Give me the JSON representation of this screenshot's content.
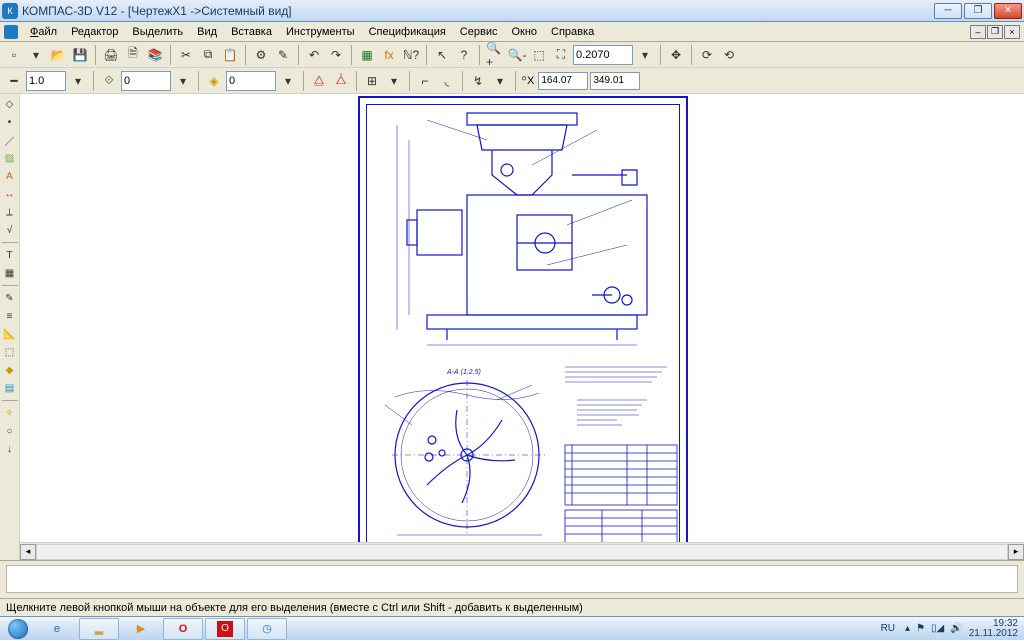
{
  "title": "КОМПАС-3D V12 - [ЧертежX1 ->Системный вид]",
  "menu": {
    "file": "Файл",
    "editor": "Редактор",
    "select": "Выделить",
    "view": "Вид",
    "insert": "Вставка",
    "tools": "Инструменты",
    "spec": "Спецификация",
    "service": "Сервис",
    "window": "Окно",
    "help": "Справка"
  },
  "toolbar1": {
    "zoom_value": "0.2070"
  },
  "toolbar2": {
    "scale_value": "1.0",
    "step_value": "0",
    "layer_value": "0",
    "coord_x": "164.07",
    "coord_y": "349.01"
  },
  "drawing": {
    "section_label": "А-А  (1:2.5)"
  },
  "status": {
    "text": "Щелкните левой кнопкой мыши на объекте для его выделения (вместе с Ctrl или Shift - добавить к выделенным)"
  },
  "tray": {
    "lang": "RU",
    "time": "19:32",
    "date": "21.11.2012"
  }
}
